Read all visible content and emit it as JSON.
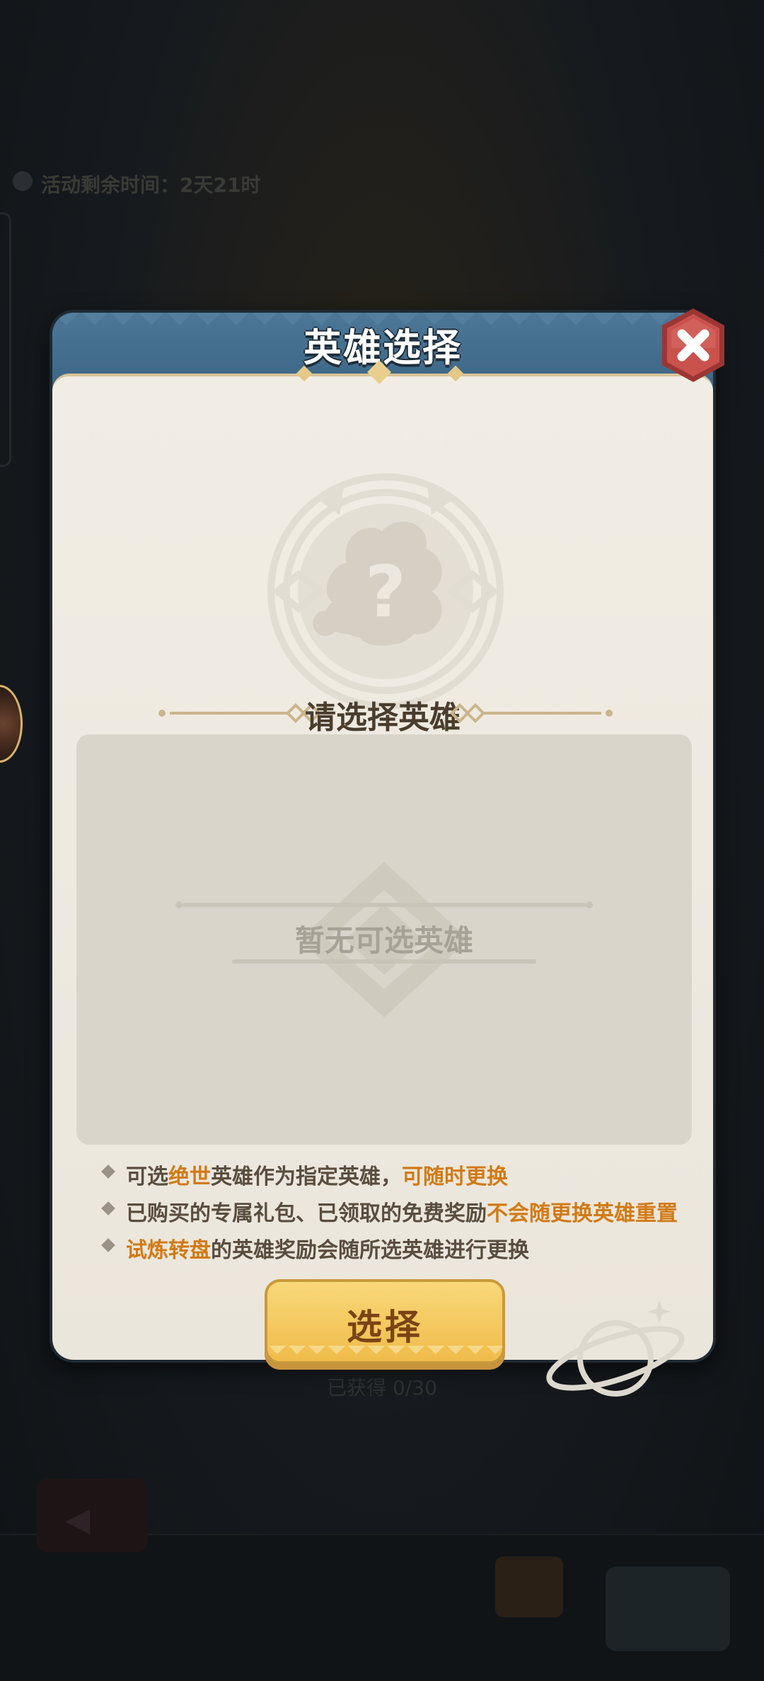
{
  "background": {
    "timer_text": "活动剩余时间：2天21时",
    "progress_text": "已获得 0/30"
  },
  "modal": {
    "title": "英雄选择",
    "section_title": "请选择英雄",
    "empty_text": "暂无可选英雄",
    "notes": [
      {
        "segments": [
          {
            "text": "可选",
            "highlight": false
          },
          {
            "text": "绝世",
            "highlight": true
          },
          {
            "text": "英雄作为指定英雄，",
            "highlight": false
          },
          {
            "text": "可随时更换",
            "highlight": true
          }
        ]
      },
      {
        "segments": [
          {
            "text": "已购买的专属礼包、已领取的免费奖励",
            "highlight": false
          },
          {
            "text": "不会随更换英雄重置",
            "highlight": true
          }
        ]
      },
      {
        "segments": [
          {
            "text": "试炼转盘",
            "highlight": true
          },
          {
            "text": "的英雄奖励会随所选英雄进行更换",
            "highlight": false
          }
        ]
      }
    ],
    "select_button_label": "选择"
  },
  "icons": {
    "close": "close-icon",
    "portrait": "unknown-hero-icon",
    "planet": "planet-icon"
  },
  "colors": {
    "header": "#3b6484",
    "highlight": "#d27a14",
    "button": "#f0bc4a",
    "close_button": "#c9524d"
  }
}
